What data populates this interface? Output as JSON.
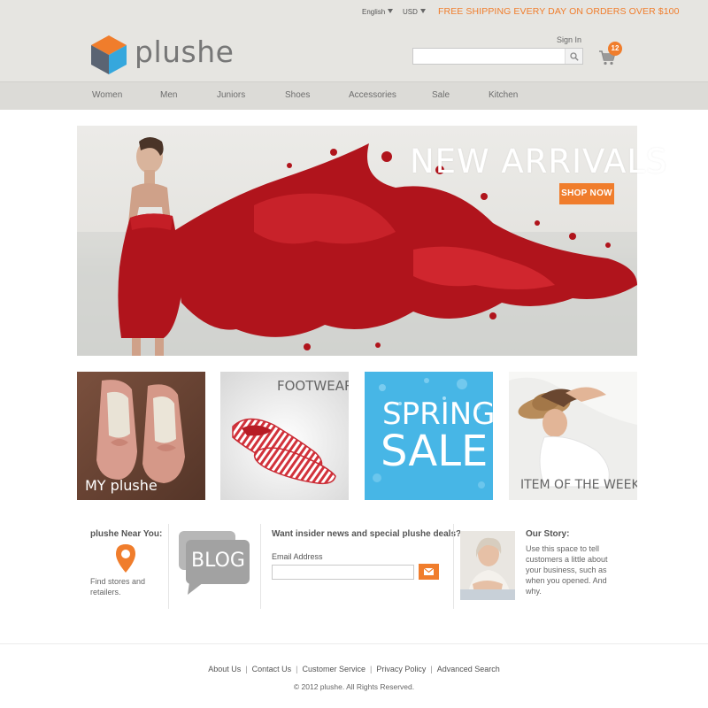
{
  "header": {
    "language": "English",
    "currency": "USD",
    "shipping_promo": "FREE SHIPPING EVERY DAY ON ORDERS OVER $100",
    "brand": "plushe",
    "sign_in": "Sign In",
    "search_placeholder": "",
    "cart_count": "12"
  },
  "nav": {
    "items": [
      "Women",
      "Men",
      "Juniors",
      "Shoes",
      "Accessories",
      "Sale",
      "Kitchen"
    ]
  },
  "hero": {
    "title": "NEW ARRIVALS",
    "cta": "SHOP NOW"
  },
  "tiles": [
    {
      "label": "MY plushe"
    },
    {
      "label": "FOOTWEAR"
    },
    {
      "label_line1": "SPRING",
      "label_line2": "SALE"
    },
    {
      "label": "ITEM OF THE WEEK"
    }
  ],
  "info": {
    "near_you_title": "plushe Near You:",
    "near_you_text": "Find stores and retailers.",
    "blog_label": "BLOG",
    "newsletter_title": "Want insider news and special plushe deals?",
    "email_label": "Email Address",
    "story_title": "Our Story:",
    "story_text": "Use this space to tell customers a little about your business, such as when you opened. And why."
  },
  "footer": {
    "links": [
      "About Us",
      "Contact Us",
      "Customer Service",
      "Privacy Policy",
      "Advanced Search"
    ],
    "copyright": "© 2012 plushe. All Rights Reserved."
  },
  "colors": {
    "accent": "#f07d2c",
    "header_bg": "#e6e5e1",
    "nav_bg": "#dcdbd7",
    "hero_red": "#b0141c",
    "spring_blue": "#47b6e6"
  }
}
